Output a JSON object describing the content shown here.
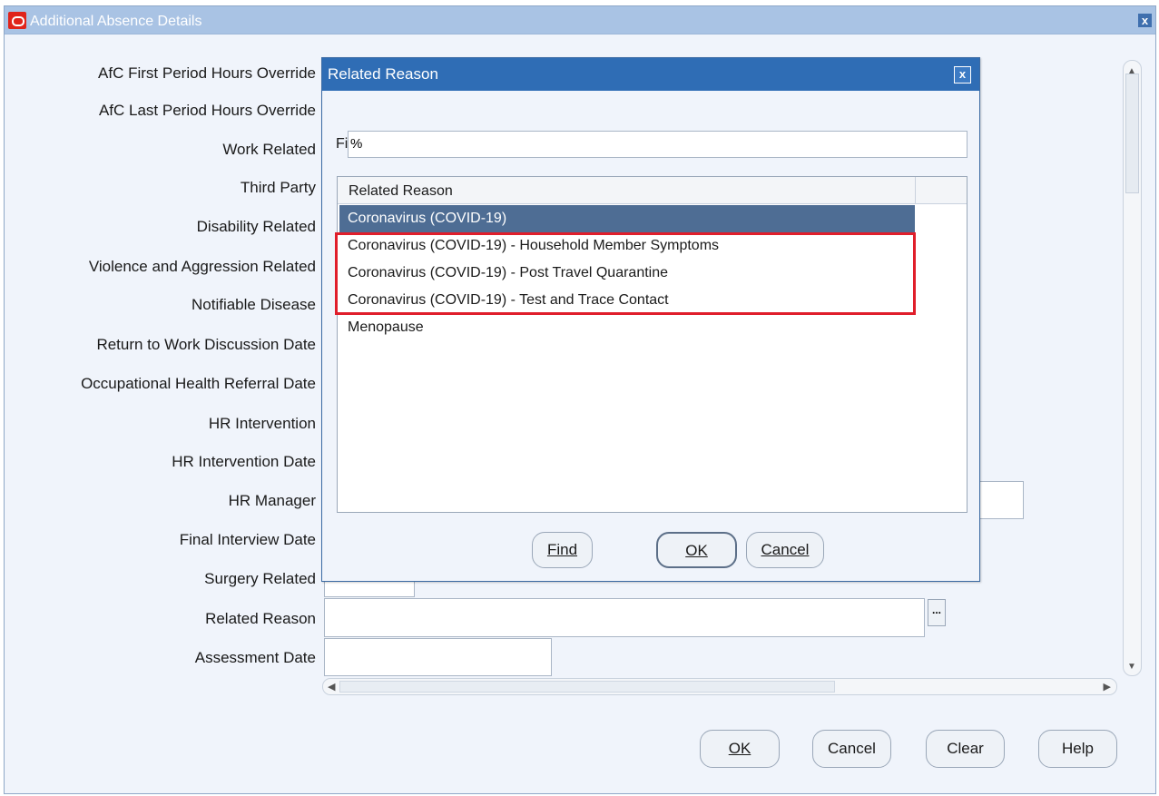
{
  "window": {
    "title": "Additional Absence Details",
    "close_label": "x"
  },
  "form": {
    "labels": [
      "AfC First Period Hours Override",
      "AfC Last Period Hours Override",
      "Work Related",
      "Third Party",
      "Disability Related",
      "Violence and Aggression Related",
      "Notifiable Disease",
      "Return to Work Discussion Date",
      "Occupational Health Referral Date",
      "HR Intervention",
      "HR Intervention Date",
      "HR Manager",
      "Final Interview Date",
      "Surgery Related",
      "Related Reason",
      "Assessment Date"
    ],
    "related_reason_value": "",
    "assessment_date_value": "",
    "lov_button_label": "..."
  },
  "buttons": {
    "ok": "OK",
    "cancel": "Cancel",
    "clear": "Clear",
    "help": "Help"
  },
  "dialog": {
    "title": "Related Reason",
    "close_label": "x",
    "find_label": "Find",
    "find_value": "%",
    "column_header": "Related Reason",
    "items": [
      "Coronavirus (COVID-19)",
      "Coronavirus (COVID-19) - Household Member Symptoms",
      "Coronavirus (COVID-19) - Post Travel Quarantine",
      "Coronavirus (COVID-19) - Test and Trace Contact",
      "Menopause"
    ],
    "selected_index": 0,
    "buttons": {
      "find": "Find",
      "ok": "OK",
      "cancel": "Cancel"
    }
  },
  "colors": {
    "titlebar": "#a9c3e4",
    "dialog_titlebar": "#2f6db5",
    "selected_row": "#4e6d94",
    "highlight_box": "#e01e2b"
  }
}
